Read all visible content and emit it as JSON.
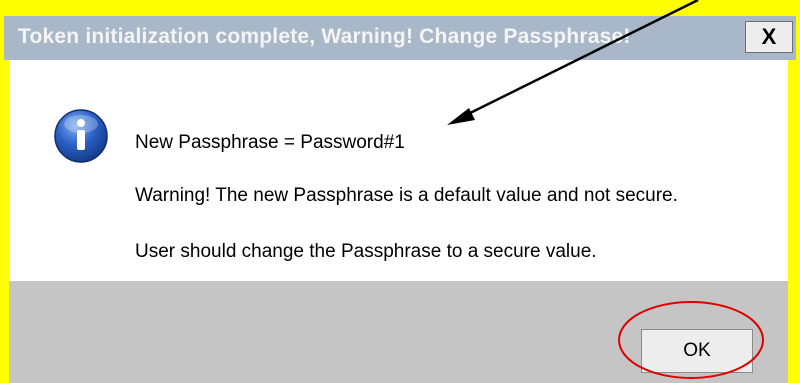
{
  "dialog": {
    "title": "Token initialization complete, Warning! Change Passphrase!",
    "close_label": "X",
    "messages": [
      "New Passphrase = Password#1",
      "Warning! The new Passphrase is a default value and not secure.",
      "User should change the Passphrase to a secure value."
    ],
    "ok_label": "OK",
    "icon": "information-icon"
  },
  "annotations": {
    "arrow_color": "#000000",
    "ok_highlight_color": "#e00000"
  },
  "colors": {
    "frame": "#ffff00",
    "titlebar": "#a9b8c8",
    "footer": "#c5c5c5"
  }
}
